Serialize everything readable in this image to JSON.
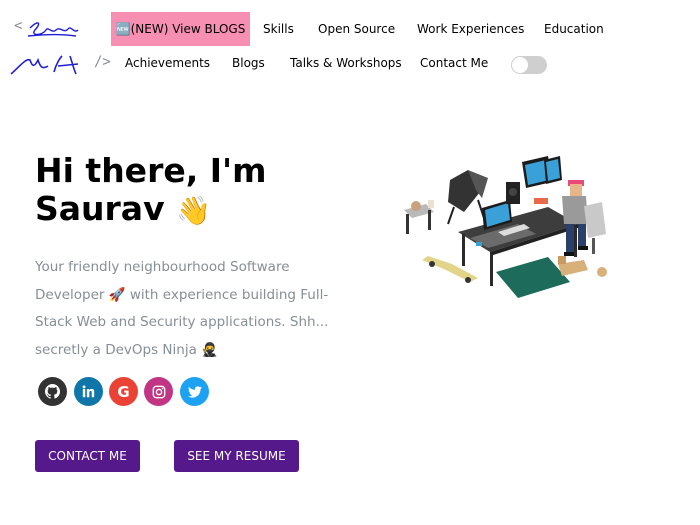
{
  "logo": {
    "open_bracket": "<",
    "close_bracket": "/>"
  },
  "nav": {
    "row1": [
      {
        "id": "nav-new-blogs",
        "label": "🆕(NEW) View BLOGS"
      },
      {
        "id": "nav-skills",
        "label": "Skills"
      },
      {
        "id": "nav-open-source",
        "label": "Open Source"
      },
      {
        "id": "nav-work-experiences",
        "label": "Work Experiences"
      },
      {
        "id": "nav-education",
        "label": "Education"
      }
    ],
    "row2": [
      {
        "id": "nav-achievements",
        "label": "Achievements"
      },
      {
        "id": "nav-blogs",
        "label": "Blogs"
      },
      {
        "id": "nav-talks",
        "label": "Talks & Workshops"
      },
      {
        "id": "nav-contact",
        "label": "Contact Me"
      }
    ],
    "theme_toggle_on": false
  },
  "hero": {
    "greeting": "Hi there, I'm Saurav",
    "wave_emoji": "👋",
    "subtitle": "Your friendly neighbourhood Software Developer 🚀 with experience building Full-Stack Web and Security applications. Shh... secretly a DevOps Ninja 🥷",
    "social": [
      {
        "name": "github-icon",
        "glyph": "⌥",
        "color": "#333333"
      },
      {
        "name": "linkedin-icon",
        "glyph": "in",
        "color": "#0e76a8"
      },
      {
        "name": "google-icon",
        "glyph": "G",
        "color": "#ea4335"
      },
      {
        "name": "instagram-icon",
        "glyph": "◎",
        "color": "#c13584"
      },
      {
        "name": "twitter-icon",
        "glyph": "🐦",
        "color": "#1da1f2"
      }
    ],
    "buttons": {
      "contact": "CONTACT ME",
      "resume": "SEE MY RESUME"
    }
  },
  "colors": {
    "accent": "#55198b",
    "nav_highlight": "#f78fb3",
    "subtitle_text": "#868e96",
    "signature": "#1f1fd6"
  }
}
